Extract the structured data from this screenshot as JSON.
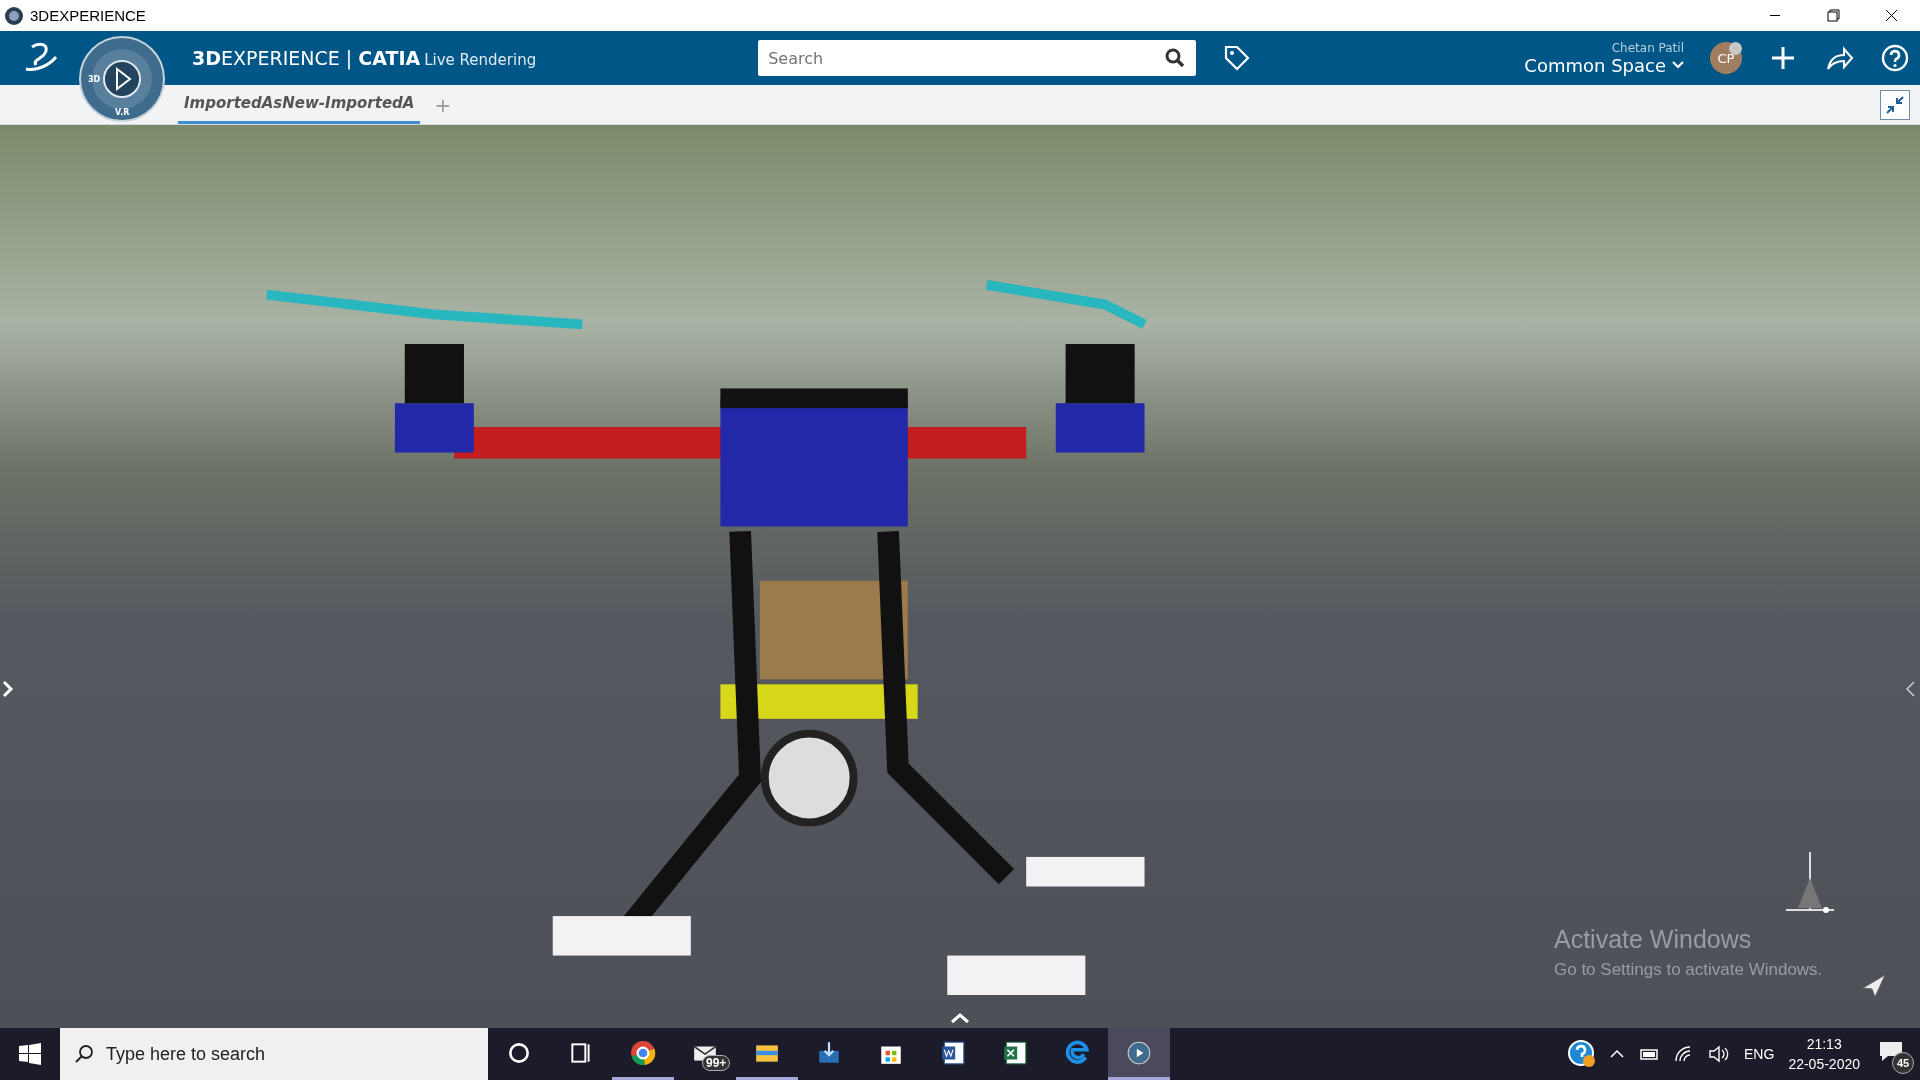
{
  "window": {
    "title": "3DEXPERIENCE"
  },
  "top_bar": {
    "brand_bold": "3D",
    "brand": "EXPERIENCE",
    "separator": "|",
    "app": "CATIA",
    "app_module": "Live Rendering",
    "search": {
      "placeholder": "Search"
    },
    "user_name": "Chetan Patil",
    "space": "Common Space",
    "avatar_initials": "CP"
  },
  "compass": {
    "labels": [
      "3D",
      "V.R"
    ]
  },
  "tabs": [
    {
      "label": "ImportedAsNew-ImportedA",
      "selected": true
    }
  ],
  "add_tab": "+",
  "viewport": {
    "overlay_title": "Activate Windows",
    "overlay_text": "Go to Settings to activate Windows."
  },
  "taskbar": {
    "search": {
      "placeholder": "Type here to search"
    },
    "apps": [
      {
        "kind": "cortana",
        "running": false,
        "selected": false
      },
      {
        "kind": "taskview",
        "running": false,
        "selected": false
      },
      {
        "kind": "chrome",
        "running": true,
        "selected": false
      },
      {
        "kind": "mail",
        "running": false,
        "selected": false,
        "badge": "99+"
      },
      {
        "kind": "explorer",
        "running": true,
        "selected": false
      },
      {
        "kind": "transfer",
        "running": false,
        "selected": false
      },
      {
        "kind": "store",
        "running": false,
        "selected": false
      },
      {
        "kind": "word",
        "running": false,
        "selected": false
      },
      {
        "kind": "excel",
        "running": false,
        "selected": false
      },
      {
        "kind": "edge",
        "running": false,
        "selected": false
      },
      {
        "kind": "experience",
        "running": true,
        "selected": true
      }
    ],
    "language": "ENG",
    "time": "21:13",
    "date": "22-05-2020",
    "notification_count": "45"
  }
}
